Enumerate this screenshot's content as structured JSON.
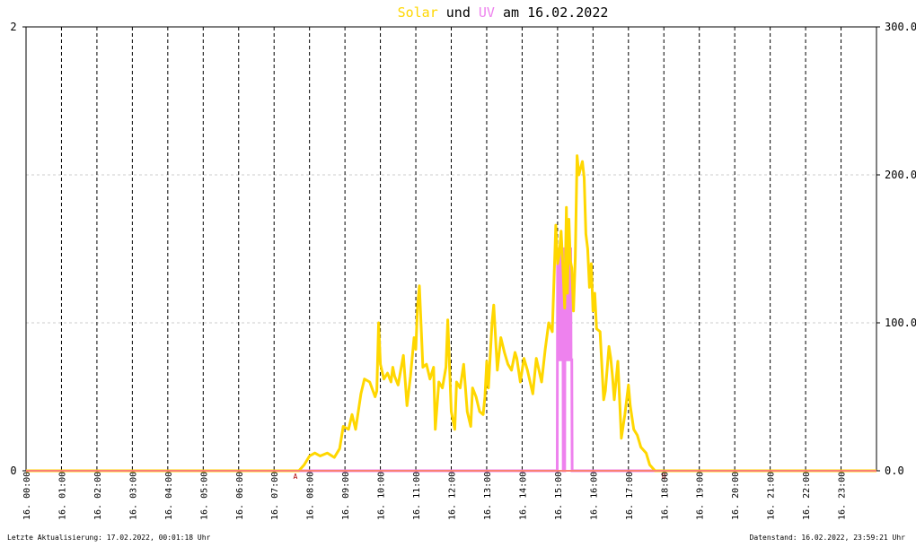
{
  "title": {
    "solar_word": "Solar",
    "und_word": " und ",
    "uv_word": "UV",
    "rest": " am 16.02.2022"
  },
  "footer": {
    "left": "Letzte Aktualisierung: 17.02.2022, 00:01:18 Uhr",
    "right": "Datenstand: 16.02.2022, 23:59:21 Uhr"
  },
  "markers": {
    "sunrise": "A",
    "sunset": "U"
  },
  "colors": {
    "solar": "#ffd700",
    "uv": "#ee82ee",
    "baseline": "#fa8072",
    "marker": "#b00000",
    "grid_h": "#cccccc",
    "grid_v": "#000000"
  },
  "chart_data": {
    "type": "line",
    "title": "Solar und UV am 16.02.2022",
    "y_left": {
      "range": [
        0,
        2
      ],
      "ticks": [
        "0",
        "2"
      ]
    },
    "y_right": {
      "range": [
        0,
        300
      ],
      "ticks": [
        "0.0",
        "100.0",
        "200.0",
        "300.0"
      ]
    },
    "x_range_hours": [
      0,
      24
    ],
    "x_tick_labels": [
      "16. 00:00",
      "16. 01:00",
      "16. 02:00",
      "16. 03:00",
      "16. 04:00",
      "16. 05:00",
      "16. 06:00",
      "16. 07:00",
      "16. 08:00",
      "16. 09:00",
      "16. 10:00",
      "16. 11:00",
      "16. 12:00",
      "16. 13:00",
      "16. 14:00",
      "16. 15:00",
      "16. 16:00",
      "16. 17:00",
      "16. 18:00",
      "16. 19:00",
      "16. 20:00",
      "16. 21:00",
      "16. 22:00",
      "16. 23:00"
    ],
    "grid": true,
    "series": [
      {
        "name": "Solar",
        "axis": "right",
        "x": [
          0,
          7.7,
          7.85,
          8.0,
          8.15,
          8.3,
          8.5,
          8.7,
          8.85,
          8.95,
          9.1,
          9.2,
          9.3,
          9.45,
          9.55,
          9.7,
          9.85,
          9.9,
          9.95,
          10.0,
          10.1,
          10.2,
          10.3,
          10.35,
          10.4,
          10.5,
          10.65,
          10.75,
          10.85,
          10.95,
          11.0,
          11.05,
          11.1,
          11.2,
          11.3,
          11.4,
          11.5,
          11.55,
          11.65,
          11.75,
          11.85,
          11.9,
          12.0,
          12.1,
          12.15,
          12.25,
          12.35,
          12.45,
          12.55,
          12.6,
          12.7,
          12.8,
          12.9,
          12.95,
          13.0,
          13.05,
          13.15,
          13.2,
          13.3,
          13.4,
          13.5,
          13.6,
          13.7,
          13.8,
          13.85,
          13.95,
          14.05,
          14.15,
          14.3,
          14.4,
          14.55,
          14.65,
          14.75,
          14.85,
          14.95,
          15.0,
          15.05,
          15.1,
          15.15,
          15.2,
          15.25,
          15.28,
          15.32,
          15.36,
          15.4,
          15.45,
          15.5,
          15.55,
          15.6,
          15.7,
          15.75,
          15.8,
          15.85,
          15.9,
          15.95,
          16.0,
          16.05,
          16.1,
          16.2,
          16.3,
          16.35,
          16.45,
          16.5,
          16.55,
          16.6,
          16.7,
          16.8,
          16.9,
          17.0,
          17.05,
          17.15,
          17.25,
          17.35,
          17.5,
          17.6,
          17.75,
          18.0,
          24
        ],
        "values": [
          0,
          0,
          4,
          10,
          12,
          10,
          12,
          9,
          15,
          30,
          28,
          38,
          28,
          52,
          62,
          60,
          50,
          54,
          100,
          72,
          62,
          66,
          60,
          70,
          64,
          58,
          78,
          44,
          64,
          90,
          82,
          112,
          125,
          70,
          72,
          62,
          70,
          28,
          60,
          56,
          70,
          102,
          40,
          28,
          60,
          56,
          72,
          40,
          30,
          56,
          50,
          40,
          38,
          50,
          74,
          56,
          100,
          112,
          68,
          90,
          80,
          72,
          68,
          80,
          76,
          60,
          76,
          68,
          52,
          76,
          60,
          82,
          100,
          94,
          166,
          140,
          146,
          162,
          138,
          110,
          178,
          120,
          170,
          142,
          137,
          108,
          144,
          213,
          200,
          209,
          198,
          160,
          150,
          124,
          140,
          108,
          120,
          96,
          94,
          48,
          54,
          84,
          76,
          64,
          48,
          74,
          22,
          38,
          58,
          44,
          28,
          24,
          16,
          12,
          4,
          0,
          0,
          0
        ]
      },
      {
        "name": "UV",
        "axis": "left",
        "x": [
          0,
          14.99,
          15.0,
          15.04,
          15.05,
          15.1,
          15.12,
          15.15,
          15.16,
          15.2,
          15.21,
          15.25,
          15.26,
          15.32,
          15.33,
          15.37,
          15.38,
          15.4,
          15.41,
          24
        ],
        "values": [
          0,
          0,
          1,
          1,
          0.5,
          0.5,
          1,
          1,
          0,
          0,
          1,
          1,
          0.5,
          0.5,
          1,
          1,
          0.5,
          0.5,
          0,
          0
        ]
      }
    ],
    "sunrise_hour": 7.6,
    "sunset_hour": 18.0
  }
}
